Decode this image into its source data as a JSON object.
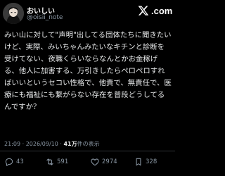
{
  "user": {
    "display_name": "おいしい",
    "handle": "@oisii_note"
  },
  "brand": {
    "logo_text": ".com",
    "color": "#ffffff"
  },
  "tweet": {
    "text": "みい山に対して\"声明\"出してる団体たちに聞きたいけど、実際、みいちゃんみたいなキチンと診断を受けてない、夜職くらいならなんとかお金稼げる、他人に加害する、万引きしたらペロペロすればいいというセコい性格で、他責で、無責任で、医療にも福祉にも繋がらない存在を普段どうしてるんですか？"
  },
  "meta": {
    "time": "21:09",
    "date": "2026/09/10",
    "separator": "·",
    "views_count": "41万",
    "views_label": "件の表示"
  },
  "actions": {
    "replies": "43",
    "retweets": "591",
    "likes": "2974",
    "bookmarks": "328"
  },
  "colors": {
    "background": "#000000",
    "text": "#e7e9ea",
    "secondary": "#8b98a5",
    "divider": "#2f3336"
  }
}
